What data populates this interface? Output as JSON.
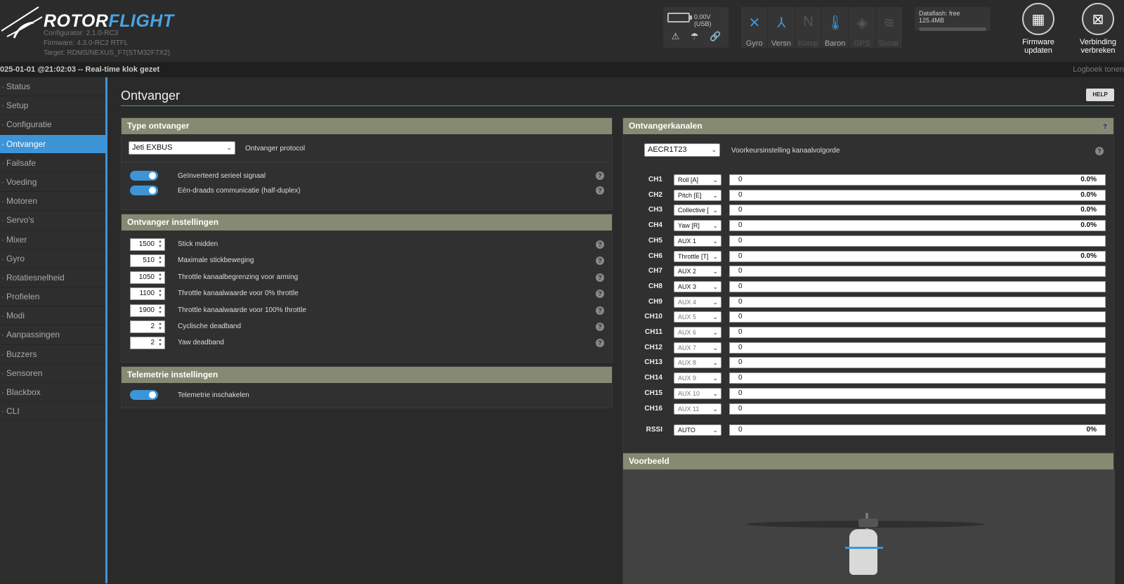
{
  "header": {
    "brand": "ROTORFLIGHT",
    "brand_a": "ROTOR",
    "brand_b": "FLIGHT",
    "configurator": "Configurator: 2.1.0-RC3",
    "firmware": "Firmware: 4.3.0-RC2 RTFL",
    "target": "Target: RDMS/NEXUS_F7(STM32F7X2)",
    "voltage": "0.00V (USB)",
    "sensors": [
      {
        "label": "Gyro",
        "icon": "gyro-icon",
        "active": true
      },
      {
        "label": "Versn",
        "icon": "accelerometer-icon",
        "active": true
      },
      {
        "label": "Komp",
        "icon": "compass-icon",
        "active": false
      },
      {
        "label": "Baron",
        "icon": "barometer-icon",
        "active": true
      },
      {
        "label": "GPS",
        "icon": "gps-icon",
        "active": false
      },
      {
        "label": "Sonar",
        "icon": "sonar-icon",
        "active": false
      }
    ],
    "dataflash": "Dataflash: free 125.4MB",
    "firmware_button": "Firmware updaten",
    "disconnect_button": "Verbinding verbreken"
  },
  "status_bar": {
    "message": "025-01-01 @21:02:03 -- Real-time klok gezet",
    "log_link": "Logboek tonen"
  },
  "sidebar": {
    "items": [
      {
        "label": "Status",
        "icon": "status-icon"
      },
      {
        "label": "Setup",
        "icon": "setup-icon"
      },
      {
        "label": "Configuratie",
        "icon": "config-icon"
      },
      {
        "label": "Ontvanger",
        "icon": "receiver-icon",
        "active": true
      },
      {
        "label": "Failsafe",
        "icon": "failsafe-icon"
      },
      {
        "label": "Voeding",
        "icon": "power-icon"
      },
      {
        "label": "Motoren",
        "icon": "motor-icon"
      },
      {
        "label": "Servo's",
        "icon": "servo-icon"
      },
      {
        "label": "Mixer",
        "icon": "mixer-icon"
      },
      {
        "label": "Gyro",
        "icon": "gyro-icon"
      },
      {
        "label": "Rotatiesnelheid",
        "icon": "rates-icon"
      },
      {
        "label": "Profielen",
        "icon": "profiles-icon"
      },
      {
        "label": "Modi",
        "icon": "modes-icon"
      },
      {
        "label": "Aanpassingen",
        "icon": "adjustments-icon"
      },
      {
        "label": "Buzzers",
        "icon": "buzzer-icon"
      },
      {
        "label": "Sensoren",
        "icon": "sensors-icon"
      },
      {
        "label": "Blackbox",
        "icon": "blackbox-icon"
      },
      {
        "label": "CLI",
        "icon": "cli-icon"
      }
    ]
  },
  "page": {
    "title": "Ontvanger",
    "help": "HELP"
  },
  "receiver_type": {
    "title": "Type ontvanger",
    "protocol_value": "Jeti EXBUS",
    "protocol_label": "Ontvanger protocol",
    "inverted_label": "Geïnverteerd serieel signaal",
    "inverted_on": true,
    "halfduplex_label": "Eén-draads communicatie (half-duplex)",
    "halfduplex_on": true
  },
  "receiver_settings": {
    "title": "Ontvanger instellingen",
    "rows": [
      {
        "value": "1500",
        "label": "Stick midden"
      },
      {
        "value": "510",
        "label": "Maximale stickbeweging"
      },
      {
        "value": "1050",
        "label": "Throttle kanaalbegrenzing voor arming"
      },
      {
        "value": "1100",
        "label": "Throttle kanaalwaarde voor 0% throttle"
      },
      {
        "value": "1900",
        "label": "Throttle kanaalwaarde voor 100% throttle"
      },
      {
        "value": "2",
        "label": "Cyclische deadband"
      },
      {
        "value": "2",
        "label": "Yaw deadband"
      }
    ]
  },
  "telemetry": {
    "title": "Telemetrie instellingen",
    "enable_label": "Telemetrie inschakelen",
    "enabled": true
  },
  "channels": {
    "title": "Ontvangerkanalen",
    "order_value": "AECR1T23",
    "order_label": "Voorkeursinstelling kanaalvolgorde",
    "rows": [
      {
        "ch": "CH1",
        "map": "Roll [A]",
        "value": "0",
        "pct": "0.0%"
      },
      {
        "ch": "CH2",
        "map": "Pitch [E]",
        "value": "0",
        "pct": "0.0%"
      },
      {
        "ch": "CH3",
        "map": "Collective [",
        "value": "0",
        "pct": "0.0%"
      },
      {
        "ch": "CH4",
        "map": "Yaw [R]",
        "value": "0",
        "pct": "0.0%"
      },
      {
        "ch": "CH5",
        "map": "AUX 1",
        "value": "0",
        "pct": ""
      },
      {
        "ch": "CH6",
        "map": "Throttle [T]",
        "value": "0",
        "pct": "0.0%"
      },
      {
        "ch": "CH7",
        "map": "AUX 2",
        "value": "0",
        "pct": ""
      },
      {
        "ch": "CH8",
        "map": "AUX 3",
        "value": "0",
        "pct": ""
      },
      {
        "ch": "CH9",
        "map": "AUX 4",
        "value": "0",
        "pct": "",
        "dim": true
      },
      {
        "ch": "CH10",
        "map": "AUX 5",
        "value": "0",
        "pct": "",
        "dim": true
      },
      {
        "ch": "CH11",
        "map": "AUX 6",
        "value": "0",
        "pct": "",
        "dim": true
      },
      {
        "ch": "CH12",
        "map": "AUX 7",
        "value": "0",
        "pct": "",
        "dim": true
      },
      {
        "ch": "CH13",
        "map": "AUX 8",
        "value": "0",
        "pct": "",
        "dim": true
      },
      {
        "ch": "CH14",
        "map": "AUX 9",
        "value": "0",
        "pct": "",
        "dim": true
      },
      {
        "ch": "CH15",
        "map": "AUX 10",
        "value": "0",
        "pct": "",
        "dim": true
      },
      {
        "ch": "CH16",
        "map": "AUX 11",
        "value": "0",
        "pct": "",
        "dim": true
      }
    ],
    "rssi": {
      "ch": "RSSI",
      "map": "AUTO",
      "value": "0",
      "pct": "0%"
    }
  },
  "preview": {
    "title": "Voorbeeld"
  },
  "colors": {
    "accent": "#3d95d8",
    "panel_header": "#878a73",
    "background": "#2a2a2a"
  }
}
